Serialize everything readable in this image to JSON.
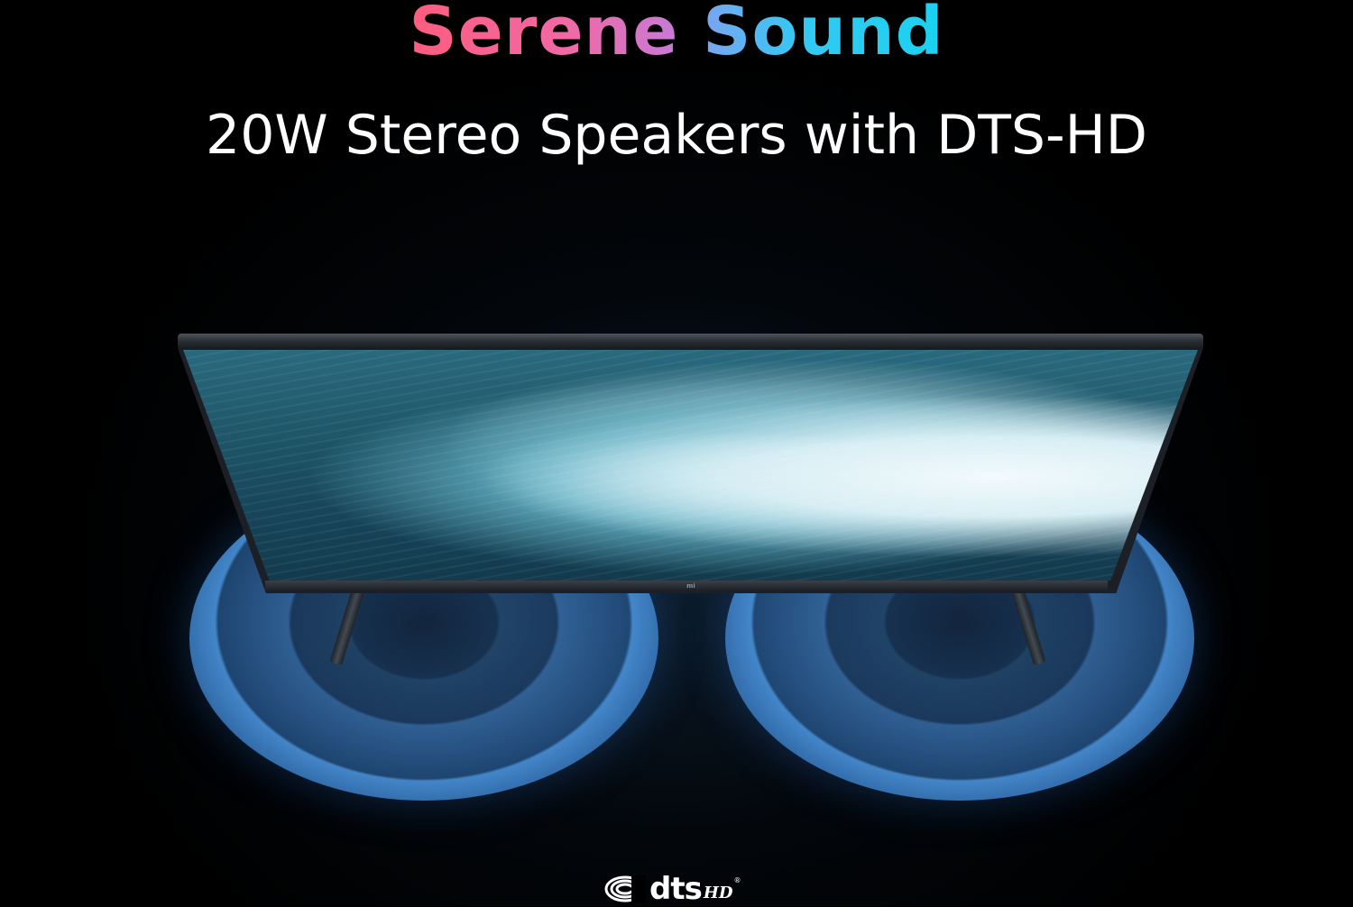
{
  "headline": {
    "word1": "Serene",
    "word2": "Sound",
    "word1_gradient": [
      "#ff5c7e",
      "#c67bd8"
    ],
    "word2_gradient": [
      "#7ba4f1",
      "#1ad2ef"
    ]
  },
  "subheadline": "20W Stereo Speakers with DTS-HD",
  "tv": {
    "logo_text": "mi"
  },
  "brand": {
    "word": "dts",
    "suffix": "HD",
    "registered": "®",
    "icon": "dts-disc-icon"
  },
  "colors": {
    "background": "#000000",
    "speaker_blue": "#3c8cdc",
    "text": "#ffffff"
  }
}
